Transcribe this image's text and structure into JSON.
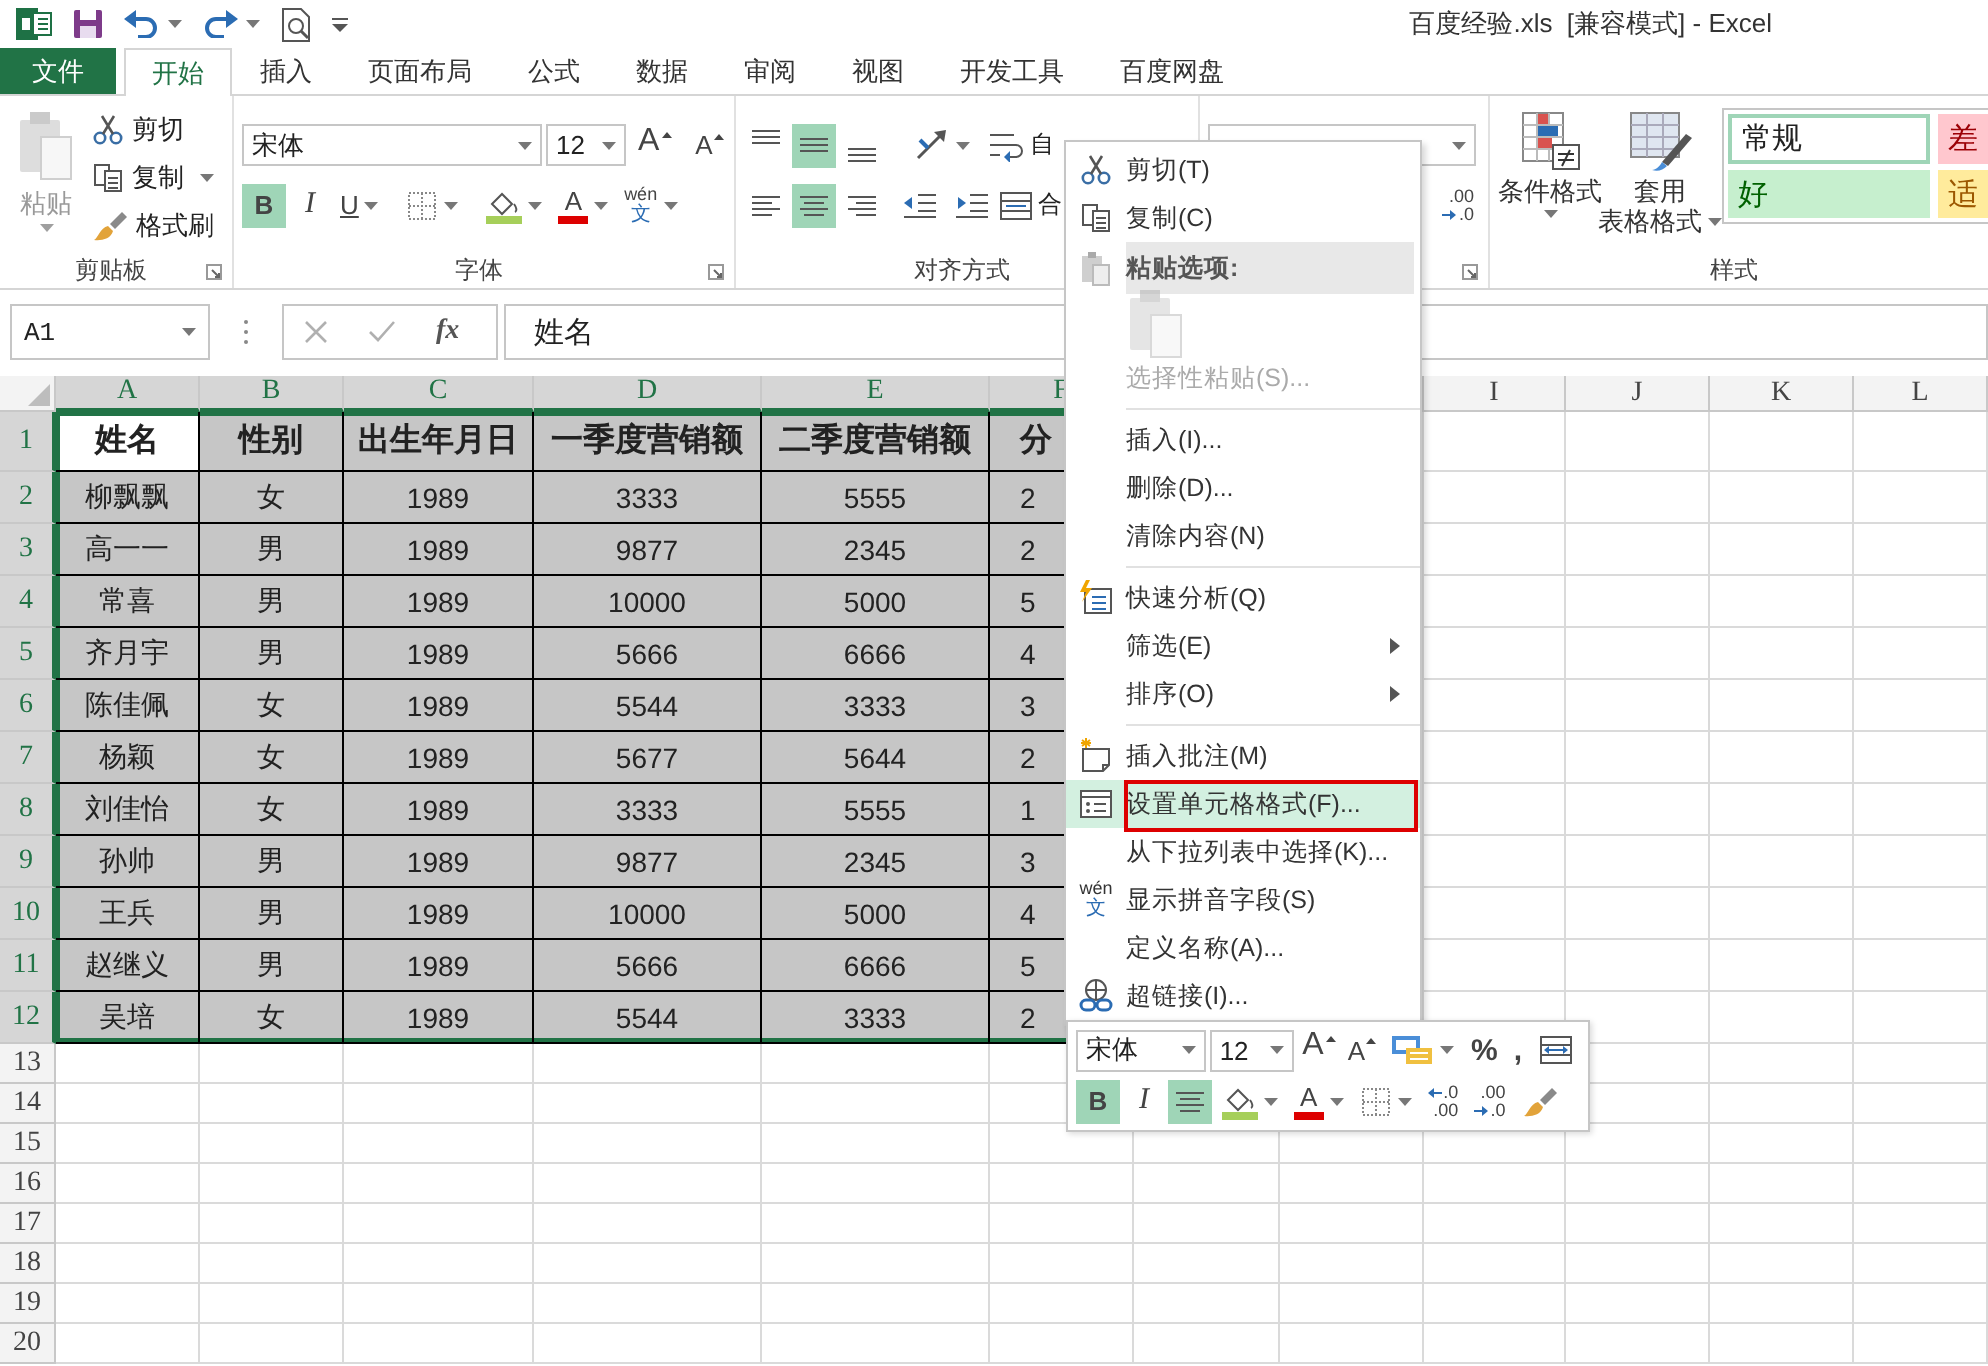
{
  "title_bar": {
    "title": "百度经验.xls  [兼容模式] - Excel"
  },
  "tabs": [
    {
      "label": "文件",
      "kind": "file",
      "selected": false
    },
    {
      "label": "开始",
      "kind": "tab",
      "selected": true
    },
    {
      "label": "插入",
      "kind": "tab",
      "selected": false
    },
    {
      "label": "页面布局",
      "kind": "tab",
      "selected": false
    },
    {
      "label": "公式",
      "kind": "tab",
      "selected": false
    },
    {
      "label": "数据",
      "kind": "tab",
      "selected": false
    },
    {
      "label": "审阅",
      "kind": "tab",
      "selected": false
    },
    {
      "label": "视图",
      "kind": "tab",
      "selected": false
    },
    {
      "label": "开发工具",
      "kind": "tab",
      "selected": false
    },
    {
      "label": "百度网盘",
      "kind": "tab",
      "selected": false
    }
  ],
  "ribbon": {
    "groups": [
      {
        "kind": "clipboard",
        "label": "剪贴板",
        "launcher": true,
        "paste": {
          "label": "粘贴",
          "disabled": true
        },
        "tools": [
          {
            "kind": "cut",
            "label": "剪切"
          },
          {
            "kind": "copy",
            "label": "复制"
          },
          {
            "kind": "painter",
            "label": "格式刷"
          }
        ]
      },
      {
        "kind": "font",
        "label": "字体",
        "launcher": true,
        "font_name": "宋体",
        "font_size": "12",
        "size_tools": [
          {
            "kind": "grow",
            "label": "A"
          },
          {
            "kind": "shrink",
            "label": "A"
          }
        ],
        "tools": [
          {
            "kind": "bold",
            "label": "B",
            "on": true
          },
          {
            "kind": "italic",
            "label": "I",
            "on": false
          },
          {
            "kind": "underline",
            "label": "U",
            "on": false
          },
          {
            "kind": "border"
          },
          {
            "kind": "fill"
          },
          {
            "kind": "font-color",
            "label": "A"
          },
          {
            "kind": "phonetic",
            "label": "wén",
            "sub": "文"
          }
        ]
      },
      {
        "kind": "alignment",
        "label": "对齐方式",
        "launcher": false,
        "rows": [
          [
            {
              "kind": "align-top",
              "on": false
            },
            {
              "kind": "align-middle",
              "on": true
            },
            {
              "kind": "align-bottom",
              "on": false
            },
            {
              "kind": "orientation"
            },
            {
              "kind": "wrap",
              "label": "自"
            }
          ],
          [
            {
              "kind": "align-left",
              "on": false
            },
            {
              "kind": "align-center",
              "on": true
            },
            {
              "kind": "align-right",
              "on": false
            },
            {
              "kind": "outdent"
            },
            {
              "kind": "indent"
            },
            {
              "kind": "merge",
              "label": "合"
            }
          ]
        ]
      },
      {
        "kind": "number",
        "launcher": true,
        "tools": [
          {
            "kind": "dec-decimal",
            "top": ".00",
            "bottom": ".0"
          }
        ]
      },
      {
        "kind": "styles",
        "label": "样式",
        "launcher": false,
        "buttons": [
          {
            "kind": "conditional",
            "lines": [
              "条件格式"
            ]
          },
          {
            "kind": "table",
            "lines": [
              "套用",
              "表格格式"
            ]
          }
        ],
        "gallery": [
          {
            "label": "常规",
            "kind": "normal",
            "selected": true
          },
          {
            "label": "差",
            "kind": "bad",
            "selected": false
          },
          {
            "label": "好",
            "kind": "good",
            "selected": false
          },
          {
            "label": "适",
            "kind": "neutral",
            "selected": false
          }
        ]
      }
    ]
  },
  "formula_bar": {
    "name_box": "A1",
    "function_label": "fx",
    "formula": "姓名"
  },
  "sheet": {
    "columns": [
      {
        "label": "A",
        "selected": true
      },
      {
        "label": "B",
        "selected": true
      },
      {
        "label": "C",
        "selected": true
      },
      {
        "label": "D",
        "selected": true
      },
      {
        "label": "E",
        "selected": true
      },
      {
        "label": "F",
        "selected": true
      },
      {
        "label": "I",
        "selected": false
      },
      {
        "label": "J",
        "selected": false
      },
      {
        "label": "K",
        "selected": false
      },
      {
        "label": "L",
        "selected": false
      }
    ],
    "header_row": {
      "header": "1",
      "selected": true,
      "cells": [
        {
          "text": "姓名",
          "active": true
        },
        {
          "text": "性别",
          "active": false
        },
        {
          "text": "出生年月日",
          "active": false
        },
        {
          "text": "一季度营销额",
          "active": false
        },
        {
          "text": "二季度营销额",
          "active": false
        },
        {
          "text": "分",
          "active": false
        }
      ]
    },
    "rows": [
      {
        "header": "2",
        "selected": true,
        "cells": [
          "柳飘飘",
          "女",
          "1989",
          "3333",
          "5555",
          "2"
        ]
      },
      {
        "header": "3",
        "selected": true,
        "cells": [
          "高一一",
          "男",
          "1989",
          "9877",
          "2345",
          "2"
        ]
      },
      {
        "header": "4",
        "selected": true,
        "cells": [
          "常喜",
          "男",
          "1989",
          "10000",
          "5000",
          "5"
        ]
      },
      {
        "header": "5",
        "selected": true,
        "cells": [
          "齐月宇",
          "男",
          "1989",
          "5666",
          "6666",
          "4"
        ]
      },
      {
        "header": "6",
        "selected": true,
        "cells": [
          "陈佳佩",
          "女",
          "1989",
          "5544",
          "3333",
          "3"
        ]
      },
      {
        "header": "7",
        "selected": true,
        "cells": [
          "杨颖",
          "女",
          "1989",
          "5677",
          "5644",
          "2"
        ]
      },
      {
        "header": "8",
        "selected": true,
        "cells": [
          "刘佳怡",
          "女",
          "1989",
          "3333",
          "5555",
          "1"
        ]
      },
      {
        "header": "9",
        "selected": true,
        "cells": [
          "孙帅",
          "男",
          "1989",
          "9877",
          "2345",
          "3"
        ]
      },
      {
        "header": "10",
        "selected": true,
        "cells": [
          "王兵",
          "男",
          "1989",
          "10000",
          "5000",
          "4"
        ]
      },
      {
        "header": "11",
        "selected": true,
        "cells": [
          "赵继义",
          "男",
          "1989",
          "5666",
          "6666",
          "5"
        ]
      },
      {
        "header": "12",
        "selected": true,
        "cells": [
          "吴培",
          "女",
          "1989",
          "5544",
          "3333",
          "2"
        ]
      }
    ],
    "empty_rows": [
      "13",
      "14",
      "15",
      "16",
      "17",
      "18",
      "19",
      "20"
    ]
  },
  "context_menu": {
    "items": [
      {
        "kind": "cut",
        "label": "剪切(T)",
        "disabled": false,
        "selected": false,
        "submenu": false
      },
      {
        "kind": "copy",
        "label": "复制(C)",
        "disabled": false,
        "selected": false,
        "submenu": false
      },
      {
        "kind": "header",
        "label": "粘贴选项:"
      },
      {
        "kind": "paste-options",
        "disabled": true
      },
      {
        "kind": "item",
        "label": "选择性粘贴(S)...",
        "disabled": true,
        "selected": false,
        "submenu": false
      },
      {
        "kind": "separator"
      },
      {
        "kind": "item",
        "label": "插入(I)...",
        "disabled": false,
        "selected": false,
        "submenu": false
      },
      {
        "kind": "item",
        "label": "删除(D)...",
        "disabled": false,
        "selected": false,
        "submenu": false
      },
      {
        "kind": "item",
        "label": "清除内容(N)",
        "disabled": false,
        "selected": false,
        "submenu": false
      },
      {
        "kind": "separator"
      },
      {
        "kind": "quick",
        "label": "快速分析(Q)",
        "disabled": false,
        "selected": false,
        "submenu": false
      },
      {
        "kind": "item",
        "label": "筛选(E)",
        "disabled": false,
        "selected": false,
        "submenu": true
      },
      {
        "kind": "item",
        "label": "排序(O)",
        "disabled": false,
        "selected": false,
        "submenu": true
      },
      {
        "kind": "separator"
      },
      {
        "kind": "comment",
        "label": "插入批注(M)",
        "disabled": false,
        "selected": false,
        "submenu": false
      },
      {
        "kind": "format",
        "label": "设置单元格格式(F)...",
        "disabled": false,
        "selected": true,
        "submenu": false
      },
      {
        "kind": "item",
        "label": "从下拉列表中选择(K)...",
        "disabled": false,
        "selected": false,
        "submenu": false
      },
      {
        "kind": "phonetic",
        "icon_label": "wén",
        "icon_sub": "文",
        "label": "显示拼音字段(S)",
        "disabled": false,
        "selected": false,
        "submenu": false
      },
      {
        "kind": "item",
        "label": "定义名称(A)...",
        "disabled": false,
        "selected": false,
        "submenu": false
      },
      {
        "kind": "link",
        "label": "超链接(I)...",
        "disabled": false,
        "selected": false,
        "submenu": false
      }
    ]
  },
  "mini_toolbar": {
    "font_name": "宋体",
    "font_size": "12",
    "upper_tools": [
      {
        "kind": "grow",
        "label": "A"
      },
      {
        "kind": "shrink",
        "label": "A"
      },
      {
        "kind": "cell-styles"
      },
      {
        "kind": "percent",
        "label": "%"
      },
      {
        "kind": "comma",
        "label": ","
      },
      {
        "kind": "merge-center"
      }
    ],
    "lower_tools": [
      {
        "kind": "bold",
        "label": "B",
        "on": true
      },
      {
        "kind": "italic",
        "label": "I",
        "on": false
      },
      {
        "kind": "align-center",
        "on": true
      },
      {
        "kind": "fill"
      },
      {
        "kind": "font-color",
        "label": "A"
      },
      {
        "kind": "border"
      },
      {
        "kind": "inc-decimal",
        "top": ".0",
        "bottom": ".00"
      },
      {
        "kind": "dec-decimal",
        "top": ".00",
        "bottom": ".0"
      },
      {
        "kind": "painter"
      }
    ]
  }
}
